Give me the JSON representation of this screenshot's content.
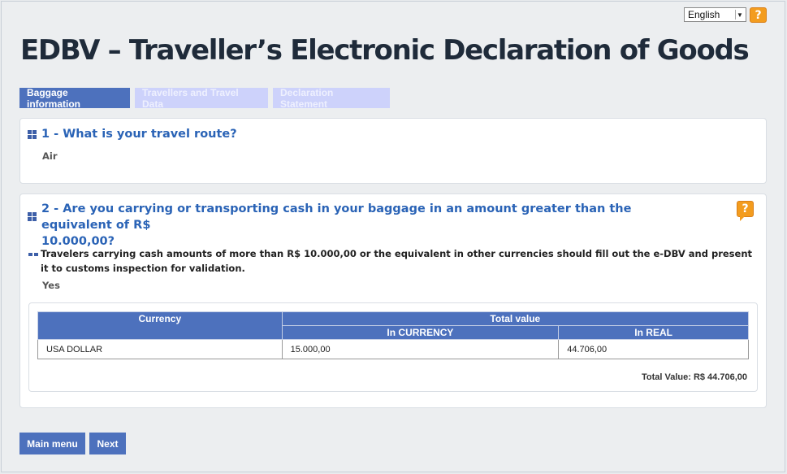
{
  "language": {
    "selected": "English"
  },
  "help_glyph": "?",
  "title": "EDBV – Traveller’s Electronic Declaration of Goods",
  "tabs": [
    {
      "label": "Baggage information",
      "active": true
    },
    {
      "label": "Travellers and Travel Data",
      "active": false
    },
    {
      "label": "Declaration Statement",
      "active": false
    }
  ],
  "q1": {
    "question": "1 - What is your travel route?",
    "answer": "Air"
  },
  "q2": {
    "question_line1": "2 - Are you carrying or transporting cash in your baggage in an amount greater than the equivalent of R$",
    "question_line2": "10.000,00?",
    "note": "Travelers carrying cash amounts of more than R$ 10.000,00 or the equivalent in other currencies should fill out the e-DBV and present it to customs inspection for validation.",
    "answer": "Yes"
  },
  "cash_table": {
    "headers": {
      "currency": "Currency",
      "total_value": "Total value",
      "in_currency": "In CURRENCY",
      "in_real": "In REAL"
    },
    "rows": [
      {
        "currency": "USA DOLLAR",
        "in_currency": "15.000,00",
        "in_real": "44.706,00"
      }
    ],
    "total": "Total Value: R$ 44.706,00"
  },
  "buttons": {
    "main_menu": "Main menu",
    "next": "Next"
  },
  "colors": {
    "accent": "#4d71bd",
    "question": "#2a63b6",
    "help": "#f39c1e",
    "tab_inactive": "#cdd2fb"
  }
}
